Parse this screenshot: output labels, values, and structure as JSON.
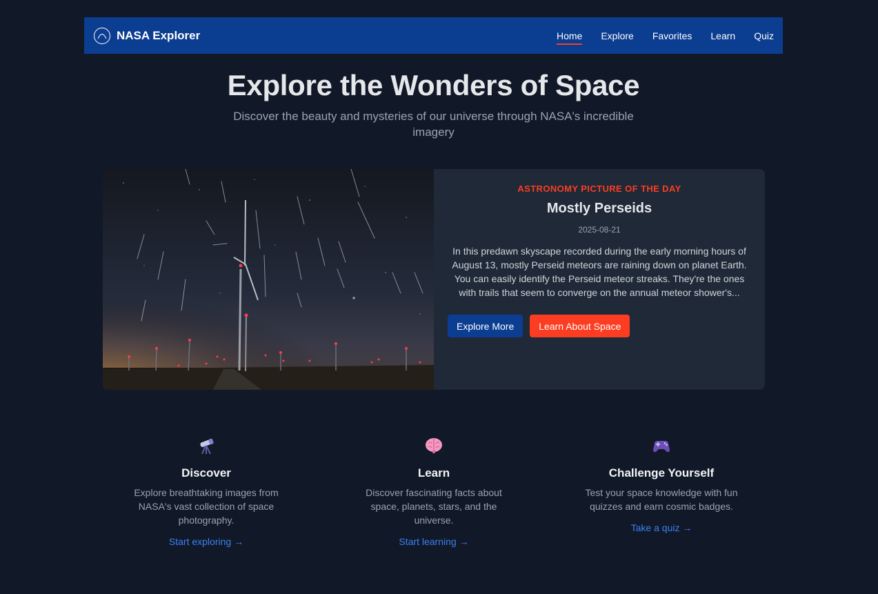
{
  "nav": {
    "brand": "NASA Explorer",
    "links": [
      {
        "label": "Home",
        "active": true
      },
      {
        "label": "Explore",
        "active": false
      },
      {
        "label": "Favorites",
        "active": false
      },
      {
        "label": "Learn",
        "active": false
      },
      {
        "label": "Quiz",
        "active": false
      }
    ]
  },
  "hero": {
    "title": "Explore the Wonders of Space",
    "subtitle": "Discover the beauty and mysteries of our universe through NASA's incredible imagery"
  },
  "apod": {
    "label": "ASTRONOMY PICTURE OF THE DAY",
    "title": "Mostly Perseids",
    "date": "2025-08-21",
    "description": "In this predawn skyscape recorded during the early morning hours of August 13, mostly Perseid meteors are raining down on planet Earth. You can easily identify the Perseid meteor streaks. They're the ones with trails that seem to converge on the annual meteor shower's...",
    "primary_button": "Explore More",
    "secondary_button": "Learn About Space"
  },
  "features": [
    {
      "icon": "telescope-icon",
      "title": "Discover",
      "description": "Explore breathtaking images from NASA's vast collection of space photography.",
      "link": "Start exploring →"
    },
    {
      "icon": "brain-icon",
      "title": "Learn",
      "description": "Discover fascinating facts about space, planets, stars, and the universe.",
      "link": "Start learning →"
    },
    {
      "icon": "game-controller-icon",
      "title": "Challenge Yourself",
      "description": "Test your space knowledge with fun quizzes and earn cosmic badges.",
      "link": "Take a quiz →"
    }
  ],
  "colors": {
    "background": "#111827",
    "nav_blue": "#0b3d91",
    "accent_red": "#fc3d21",
    "card": "#1f2937",
    "link_blue": "#3b82f6"
  }
}
